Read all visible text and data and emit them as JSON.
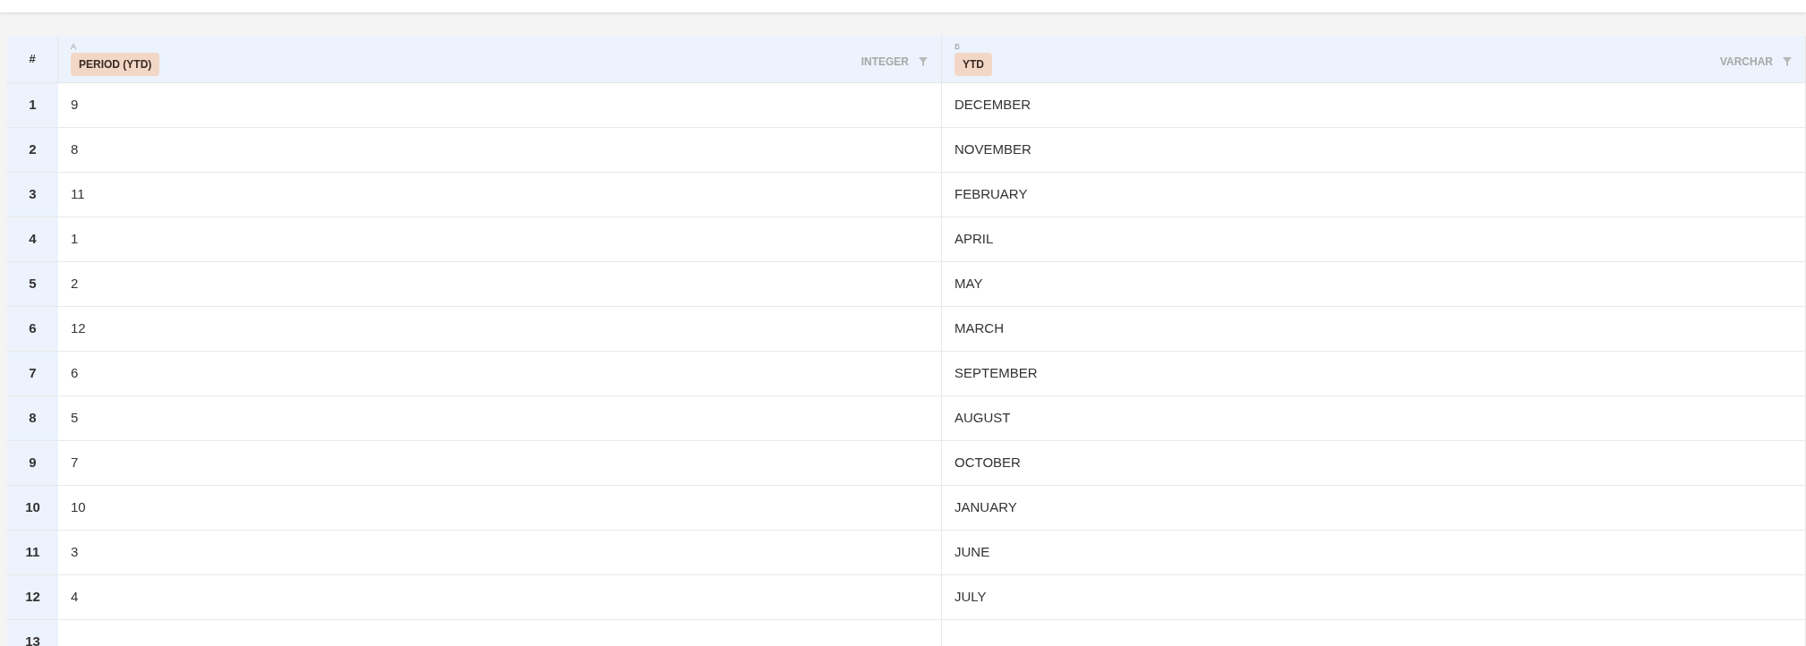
{
  "table": {
    "index_header": "#",
    "columns": [
      {
        "letter": "A",
        "name": "PERIOD (YTD)",
        "type": "INTEGER"
      },
      {
        "letter": "B",
        "name": "YTD",
        "type": "VARCHAR"
      }
    ],
    "rows": [
      {
        "number": "1",
        "cells": [
          "9",
          "DECEMBER"
        ]
      },
      {
        "number": "2",
        "cells": [
          "8",
          "NOVEMBER"
        ]
      },
      {
        "number": "3",
        "cells": [
          "11",
          "FEBRUARY"
        ]
      },
      {
        "number": "4",
        "cells": [
          "1",
          "APRIL"
        ]
      },
      {
        "number": "5",
        "cells": [
          "2",
          "MAY"
        ]
      },
      {
        "number": "6",
        "cells": [
          "12",
          "MARCH"
        ]
      },
      {
        "number": "7",
        "cells": [
          "6",
          "SEPTEMBER"
        ]
      },
      {
        "number": "8",
        "cells": [
          "5",
          "AUGUST"
        ]
      },
      {
        "number": "9",
        "cells": [
          "7",
          "OCTOBER"
        ]
      },
      {
        "number": "10",
        "cells": [
          "10",
          "JANUARY"
        ]
      },
      {
        "number": "11",
        "cells": [
          "3",
          "JUNE"
        ]
      },
      {
        "number": "12",
        "cells": [
          "4",
          "JULY"
        ]
      },
      {
        "number": "13"
      }
    ]
  }
}
